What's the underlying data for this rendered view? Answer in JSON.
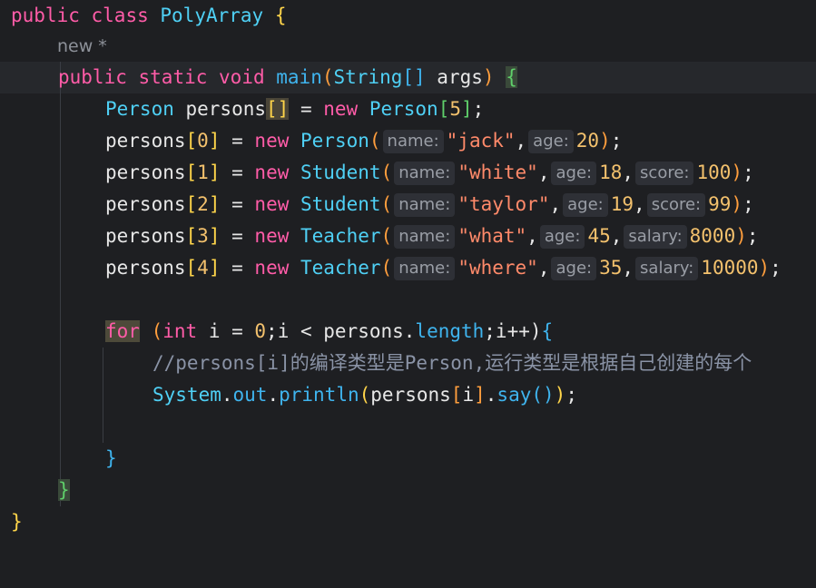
{
  "code": {
    "l1": {
      "kw1": "public",
      "kw2": "class",
      "cls": "PolyArray",
      "brace": "{"
    },
    "author_hint": "new *",
    "l2": {
      "kw1": "public",
      "kw2": "static",
      "kw3": "void",
      "fn": "main",
      "p1": "(",
      "type": "String",
      "arr": "[]",
      "arg": " args",
      "p2": ")",
      "brace": "{"
    },
    "l3": {
      "type": "Person",
      "var": " persons",
      "arr": "[]",
      "eq": " = ",
      "kw": "new",
      "type2": " Person",
      "ob": "[",
      "num": "5",
      "cb": "]",
      "end": ";"
    },
    "rows": [
      {
        "lhs": "persons",
        "idx": "0",
        "cls": "Person",
        "args": [
          {
            "hint": "name:",
            "val": "\"jack\"",
            "kind": "str"
          },
          {
            "hint": "age:",
            "val": "20",
            "kind": "num"
          }
        ]
      },
      {
        "lhs": "persons",
        "idx": "1",
        "cls": "Student",
        "args": [
          {
            "hint": "name:",
            "val": "\"white\"",
            "kind": "str"
          },
          {
            "hint": "age:",
            "val": "18",
            "kind": "num"
          },
          {
            "hint": "score:",
            "val": "100",
            "kind": "num"
          }
        ]
      },
      {
        "lhs": "persons",
        "idx": "2",
        "cls": "Student",
        "args": [
          {
            "hint": "name:",
            "val": "\"taylor\"",
            "kind": "str"
          },
          {
            "hint": "age:",
            "val": "19",
            "kind": "num"
          },
          {
            "hint": "score:",
            "val": "99",
            "kind": "num"
          }
        ]
      },
      {
        "lhs": "persons",
        "idx": "3",
        "cls": "Teacher",
        "args": [
          {
            "hint": "name:",
            "val": "\"what\"",
            "kind": "str"
          },
          {
            "hint": "age:",
            "val": "45",
            "kind": "num"
          },
          {
            "hint": "salary:",
            "val": "8000",
            "kind": "num"
          }
        ]
      },
      {
        "lhs": "persons",
        "idx": "4",
        "cls": "Teacher",
        "args": [
          {
            "hint": "name:",
            "val": "\"where\"",
            "kind": "str"
          },
          {
            "hint": "age:",
            "val": "35",
            "kind": "num"
          },
          {
            "hint": "salary:",
            "val": "10000",
            "kind": "num"
          }
        ]
      }
    ],
    "for_line": {
      "kw": "for",
      "p1": " (",
      "kw2": "int",
      "rest1": " i = ",
      "num": "0",
      "rest2": ";i < persons.",
      "field": "length",
      "rest3": ";i++)",
      "brace": "{"
    },
    "comment": "//persons[i]的编译类型是Person,运行类型是根据自己创建的每个",
    "print_line": {
      "cls": "System",
      "dot1": ".",
      "field": "out",
      "dot2": ".",
      "fn": "println",
      "p1": "(",
      "arg": "persons",
      "ob": "[",
      "idx": "i",
      "cb": "]",
      "dot3": ".",
      "fn2": "say",
      "p2": "()",
      "p3": ")",
      "end": ";"
    },
    "close_for": "}",
    "close_main": "}",
    "close_class": "}"
  },
  "colors": {
    "background": "#1e1f22",
    "keyword": "#ff5ca8",
    "class": "#4fd0f5",
    "string": "#ff8a6a",
    "number": "#f3c16d"
  }
}
